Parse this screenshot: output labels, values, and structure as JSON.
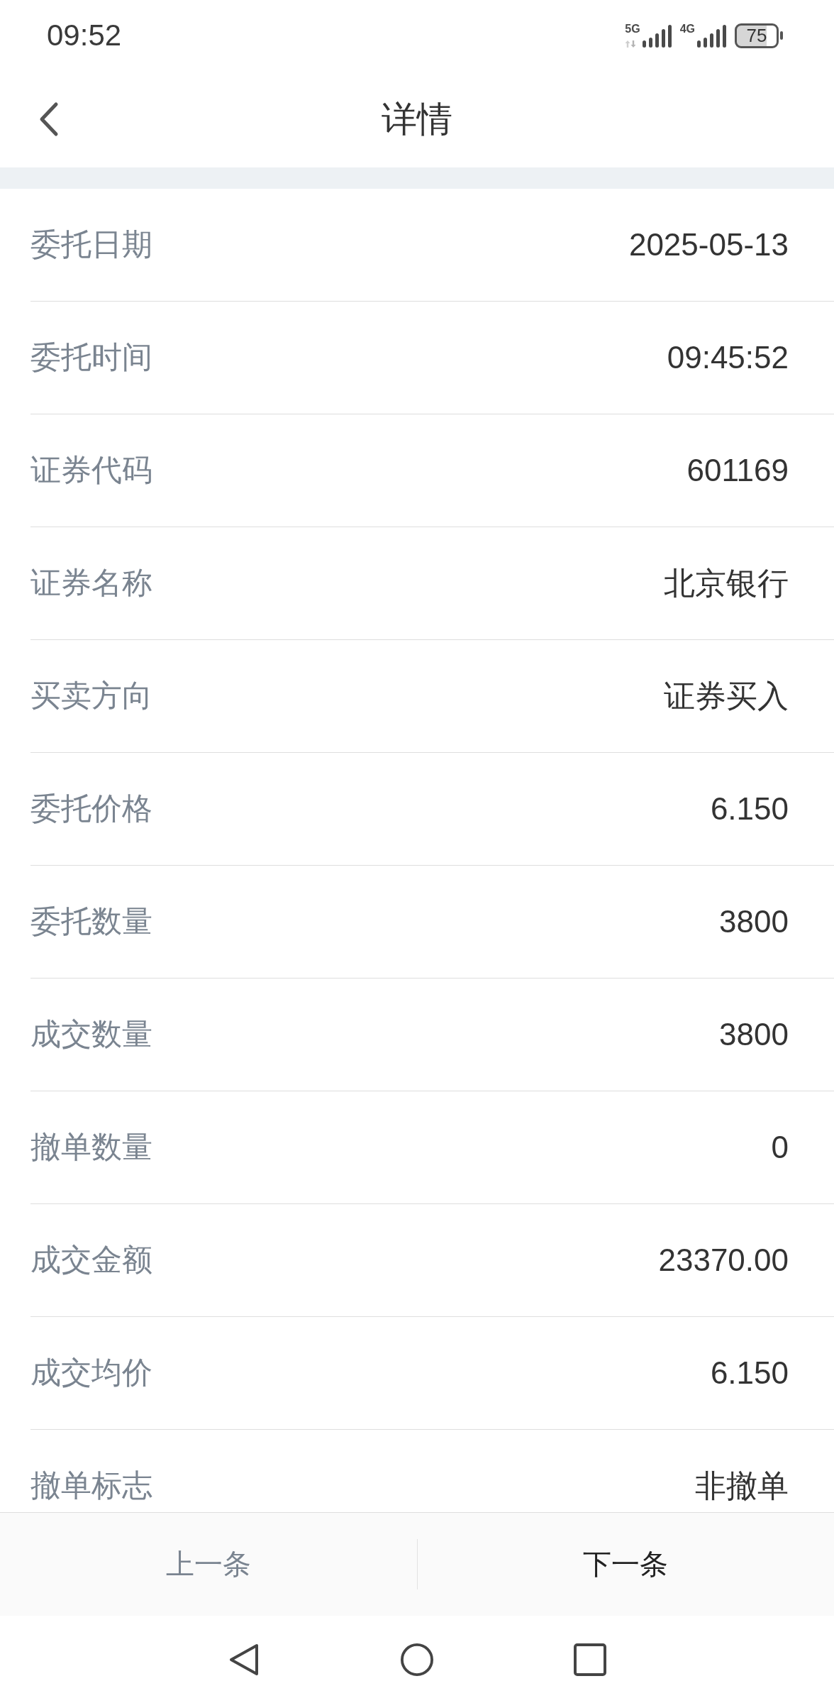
{
  "status_bar": {
    "time": "09:52",
    "networks": [
      {
        "label": "5G",
        "data_arrows": true
      },
      {
        "label": "4G",
        "data_arrows": false
      }
    ],
    "battery": "75"
  },
  "header": {
    "title": "详情"
  },
  "details": [
    {
      "label": "委托日期",
      "value": "2025-05-13"
    },
    {
      "label": "委托时间",
      "value": "09:45:52"
    },
    {
      "label": "证券代码",
      "value": "601169"
    },
    {
      "label": "证券名称",
      "value": "北京银行"
    },
    {
      "label": "买卖方向",
      "value": "证券买入"
    },
    {
      "label": "委托价格",
      "value": "6.150"
    },
    {
      "label": "委托数量",
      "value": "3800"
    },
    {
      "label": "成交数量",
      "value": "3800"
    },
    {
      "label": "撤单数量",
      "value": "0"
    },
    {
      "label": "成交金额",
      "value": "23370.00"
    },
    {
      "label": "成交均价",
      "value": "6.150"
    },
    {
      "label": "撤单标志",
      "value": "非撤单"
    }
  ],
  "bottom_bar": {
    "buttons": [
      {
        "label": "上一条",
        "disabled": true
      },
      {
        "label": "下一条",
        "disabled": false
      }
    ]
  }
}
